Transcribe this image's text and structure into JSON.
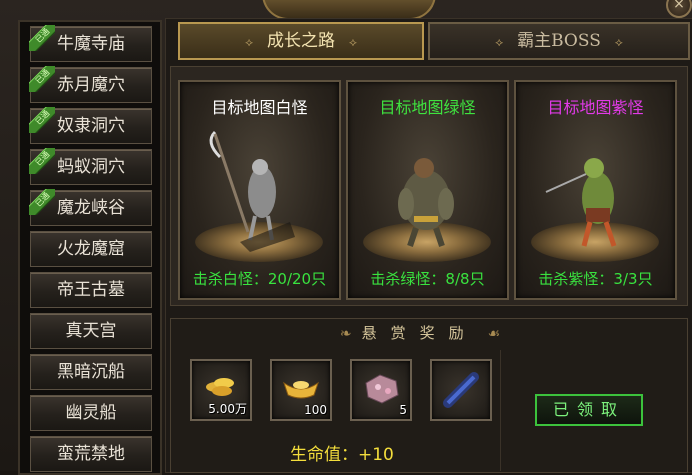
{
  "window": {
    "close_label": "×"
  },
  "sidebar": {
    "badge_label": "已通",
    "items": [
      {
        "label": "牛魔寺庙",
        "completed": true
      },
      {
        "label": "赤月魔穴",
        "completed": true
      },
      {
        "label": "奴隶洞穴",
        "completed": true
      },
      {
        "label": "蚂蚁洞穴",
        "completed": true
      },
      {
        "label": "魔龙峡谷",
        "completed": true
      },
      {
        "label": "火龙魔窟",
        "completed": false
      },
      {
        "label": "帝王古墓",
        "completed": false
      },
      {
        "label": "真天宫",
        "completed": false
      },
      {
        "label": "黑暗沉船",
        "completed": false
      },
      {
        "label": "幽灵船",
        "completed": false
      },
      {
        "label": "蛮荒禁地",
        "completed": false
      }
    ]
  },
  "tabs": [
    {
      "label": "成长之路",
      "active": true
    },
    {
      "label": "霸主BOSS",
      "active": false
    }
  ],
  "targets": [
    {
      "title": "目标地图白怪",
      "title_color": "#ffffff",
      "kill_text": "击杀白怪：20/20只",
      "kills": 20,
      "kills_required": 20,
      "monster": "reaper-icon"
    },
    {
      "title": "目标地图绿怪",
      "title_color": "#3fe23f",
      "kill_text": "击杀绿怪：8/8只",
      "kills": 8,
      "kills_required": 8,
      "monster": "ogre-icon"
    },
    {
      "title": "目标地图紫怪",
      "title_color": "#e23ae8",
      "kill_text": "击杀紫怪：3/3只",
      "kills": 3,
      "kills_required": 3,
      "monster": "orc-icon"
    }
  ],
  "reward": {
    "title": "悬赏奖励",
    "items": [
      {
        "icon": "gold-coins-icon",
        "count": "5.00万"
      },
      {
        "icon": "gold-ingot-icon",
        "count": "100"
      },
      {
        "icon": "gem-ore-icon",
        "count": "5"
      },
      {
        "icon": "scroll-icon",
        "count": ""
      }
    ],
    "hp_text": "生命值：+10",
    "claim_label": "已领取"
  }
}
